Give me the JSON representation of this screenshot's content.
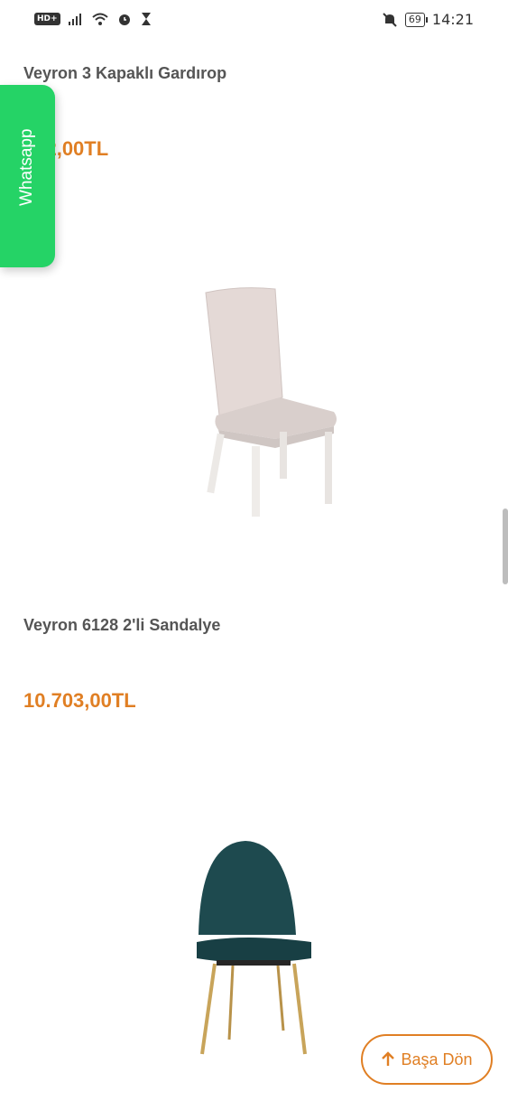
{
  "status_bar": {
    "hd_badge": "HD+",
    "battery": "69",
    "time": "14:21",
    "icons": [
      "signal-icon",
      "wifi-icon",
      "alarm-icon",
      "hourglass-icon",
      "mute-icon",
      "battery-icon"
    ]
  },
  "products": [
    {
      "title": "Veyron 3 Kapaklı Gardırop",
      "price": "852,00TL"
    },
    {
      "title": "Veyron 6128 2'li Sandalye",
      "price": "10.703,00TL"
    }
  ],
  "whatsapp": {
    "label": "Whatsapp",
    "color": "#25d366"
  },
  "back_to_top": {
    "label": "Başa Dön"
  },
  "colors": {
    "accent": "#e07f24",
    "title": "#555555"
  }
}
